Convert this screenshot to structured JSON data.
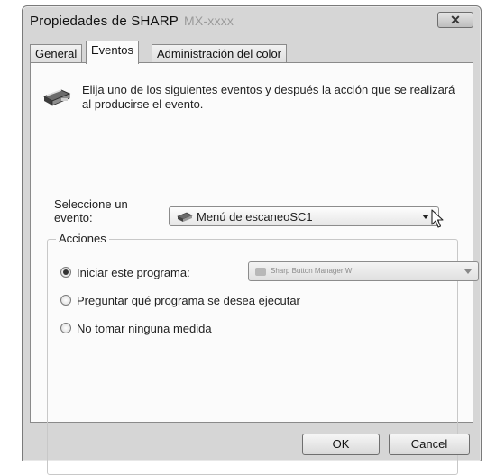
{
  "window": {
    "title": "Propiedades de SHARP",
    "title_model": "MX-xxxx",
    "close_glyph": "✕"
  },
  "tabs": [
    {
      "label": "General",
      "active": false
    },
    {
      "label": "Eventos",
      "active": true
    },
    {
      "label": "Administración del color",
      "active": false
    }
  ],
  "intro_text": "Elija uno de los siguientes eventos y después la acción que se realizará al producirse el evento.",
  "event_select": {
    "label": "Seleccione un evento:",
    "value": "Menú de escaneoSC1",
    "icon": "scanner-icon"
  },
  "actions": {
    "legend": "Acciones",
    "options": [
      {
        "label": "Iniciar este programa:",
        "selected": true
      },
      {
        "label": "Preguntar qué programa se desea ejecutar",
        "selected": false
      },
      {
        "label": "No tomar ninguna medida",
        "selected": false
      }
    ],
    "program_value": "Sharp Button Manager W"
  },
  "buttons": {
    "ok": "OK",
    "cancel": "Cancel"
  },
  "colors": {
    "window_frame": "#d6d6d6",
    "panel_background": "#fbfbfb",
    "border": "#8a8a8a"
  }
}
